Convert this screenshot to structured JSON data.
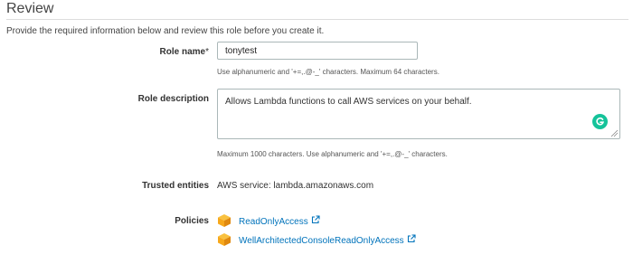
{
  "header": {
    "title": "Review",
    "intro": "Provide the required information below and review this role before you create it."
  },
  "role_name": {
    "label": "Role name",
    "required_mark": "*",
    "value": "tonytest",
    "hint": "Use alphanumeric and '+=,.@-_' characters. Maximum 64 characters."
  },
  "role_description": {
    "label": "Role description",
    "value": "Allows Lambda functions to call AWS services on your behalf.",
    "hint": "Maximum 1000 characters. Use alphanumeric and '+=,.@-_' characters."
  },
  "trusted_entities": {
    "label": "Trusted entities",
    "value": "AWS service: lambda.amazonaws.com"
  },
  "policies": {
    "label": "Policies",
    "items": [
      {
        "name": "ReadOnlyAccess",
        "icon": "policy-cube-icon"
      },
      {
        "name": "WellArchitectedConsoleReadOnlyAccess",
        "icon": "policy-cube-icon"
      }
    ]
  },
  "colors": {
    "link": "#0073bb",
    "policy_icon": "#f7a81b",
    "grammarly": "#15c39a",
    "border": "#aab7b8"
  }
}
